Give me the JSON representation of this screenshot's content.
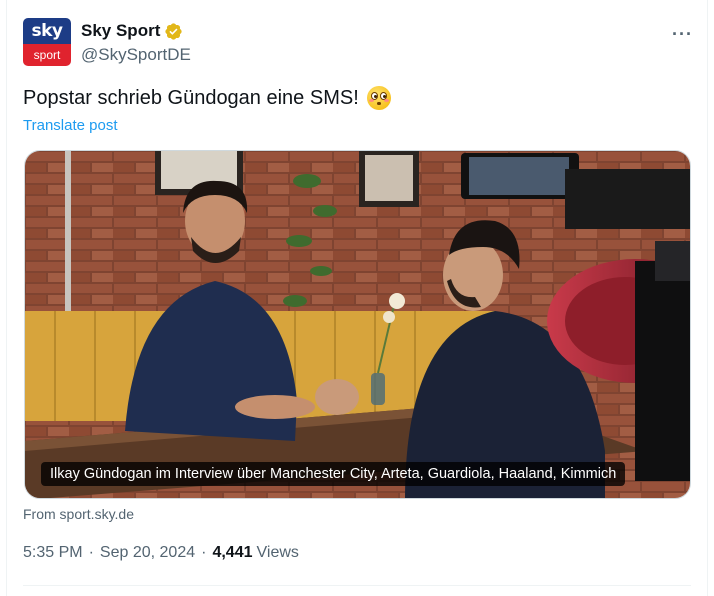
{
  "author": {
    "avatar_top": "sky",
    "avatar_bottom": "sport",
    "name": "Sky Sport",
    "handle": "@SkySportDE",
    "verified_icon": "verified-badge-gold"
  },
  "tweet": {
    "text": "Popstar schrieb Gündogan eine SMS!",
    "emoji": "flushed-face",
    "translate_label": "Translate post"
  },
  "media": {
    "caption": "Ilkay Gündogan im Interview über Manchester City, Arteta, Guardiola, Haaland, Kimmich"
  },
  "source": "From sport.sky.de",
  "meta": {
    "time": "5:35 PM",
    "date": "Sep 20, 2024",
    "views_count": "4,441",
    "views_label": "Views"
  },
  "colors": {
    "link": "#1d9bf0",
    "verified": "#e2b719",
    "sky_blue": "#1d3c86",
    "sky_red": "#e0232e"
  }
}
